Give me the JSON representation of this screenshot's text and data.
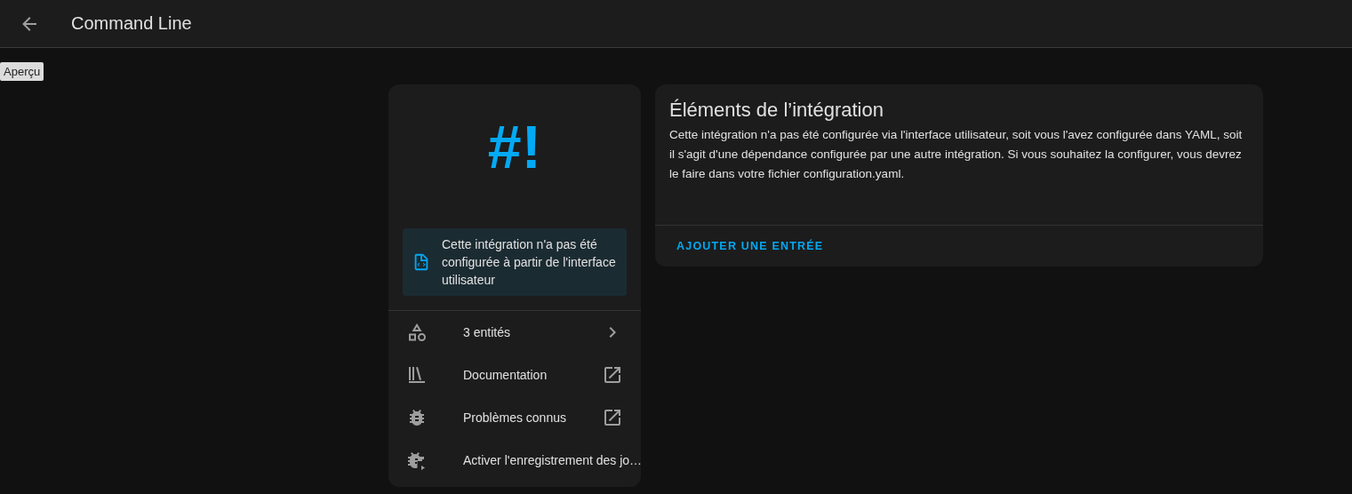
{
  "header": {
    "title": "Command Line"
  },
  "tooltip": "Aperçu",
  "info_card": {
    "logo": "#!",
    "notice": "Cette intégration n'a pas été configurée à partir de l'interface utilisateur",
    "items": [
      {
        "label": "3 entités",
        "kind": "navigate"
      },
      {
        "label": "Documentation",
        "kind": "external"
      },
      {
        "label": "Problèmes connus",
        "kind": "external"
      },
      {
        "label": "Activer l'enregistrement des jo…",
        "kind": "action"
      }
    ]
  },
  "entries_card": {
    "title": "Éléments de l’intégration",
    "text": "Cette intégration n'a pas été configurée via l'interface utilisateur, soit vous l'avez configurée dans YAML, soit il s'agit d'une dépendance configurée par une autre intégration. Si vous souhaitez la configurer, vous devrez le faire dans votre fichier configuration.yaml.",
    "button": "AJOUTER UNE ENTRÉE"
  }
}
